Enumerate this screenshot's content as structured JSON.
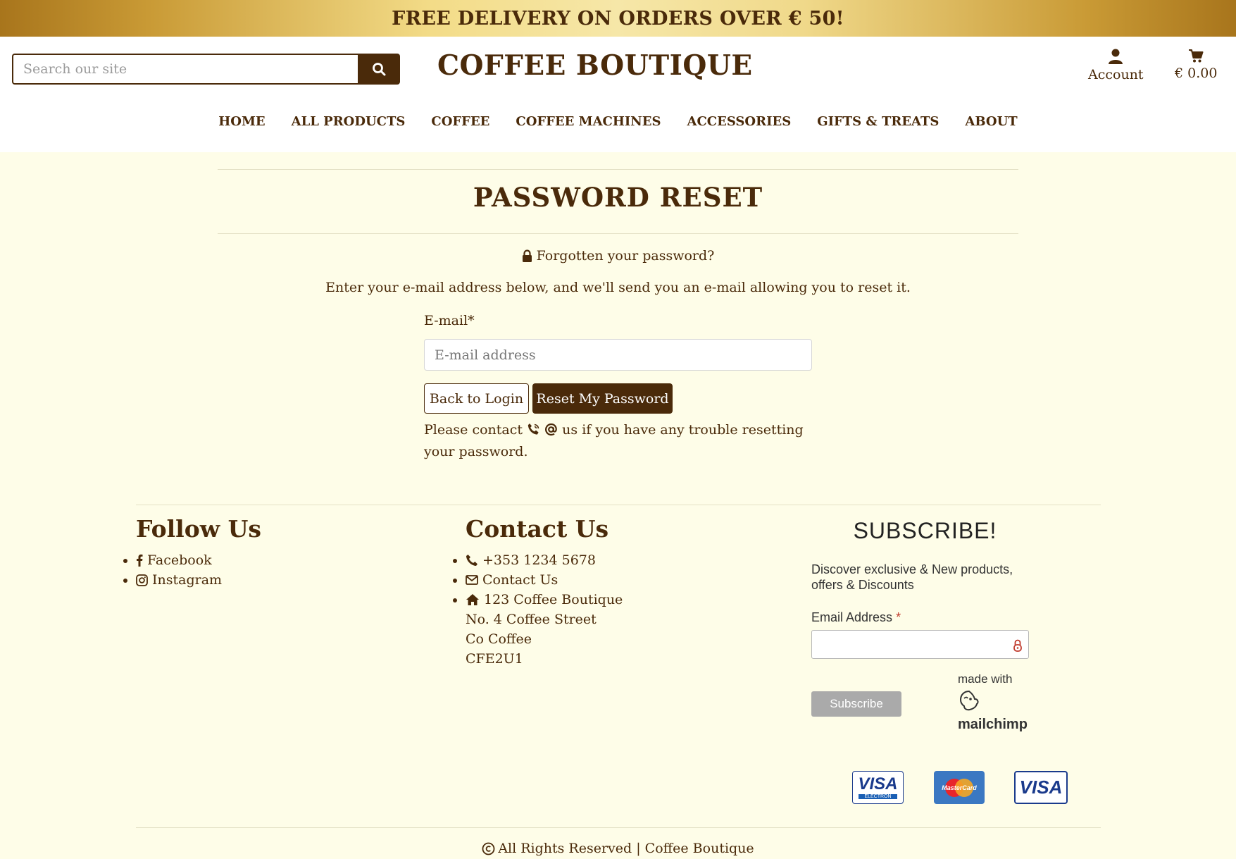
{
  "promo": {
    "text": "FREE DELIVERY ON ORDERS OVER € 50!"
  },
  "header": {
    "search_placeholder": "Search our site",
    "brand": "COFFEE BOUTIQUE",
    "account_label": "Account",
    "cart_total": "€ 0.00"
  },
  "nav": {
    "items": [
      "HOME",
      "ALL PRODUCTS",
      "COFFEE",
      "COFFEE MACHINES",
      "ACCESSORIES",
      "GIFTS & TREATS",
      "ABOUT"
    ]
  },
  "main": {
    "title": "PASSWORD RESET",
    "forgot": "Forgotten your password?",
    "instructions": "Enter your e-mail address below, and we'll send you an e-mail allowing you to reset it.",
    "email_label": "E-mail*",
    "email_placeholder": "E-mail address",
    "back_button": "Back to Login",
    "reset_button": "Reset My Password",
    "contact_pre": "Please contact",
    "contact_post": "us if you have any trouble resetting your password."
  },
  "footer": {
    "follow_title": "Follow Us",
    "follow_links": [
      "Facebook",
      "Instagram"
    ],
    "contact_title": "Contact Us",
    "phone": "+353 1234 5678",
    "contact_link": "Contact Us",
    "address": [
      "123 Coffee Boutique",
      "No. 4 Coffee Street",
      "Co Coffee",
      "CFE2U1"
    ],
    "subscribe_title": "SUBSCRIBE!",
    "subscribe_desc": "Discover exclusive & New products, offers & Discounts",
    "subscribe_label": "Email Address",
    "subscribe_required": "*",
    "subscribe_button": "Subscribe",
    "mailchimp_made": "made with",
    "mailchimp_brand": "mailchimp",
    "cards": [
      "VISA",
      "MasterCard",
      "VISA"
    ],
    "card_sub": "ELECTRON",
    "copyright": "All Rights Reserved | Coffee Boutique"
  },
  "colors": {
    "brand": "#4a2a0a",
    "page_bg": "#fefde8",
    "gold": "#d4ab4a"
  },
  "icons": [
    "search-icon",
    "user-icon",
    "cart-icon",
    "lock-icon",
    "phone-icon",
    "at-icon",
    "facebook-icon",
    "instagram-icon",
    "envelope-icon",
    "home-icon",
    "copyright-icon"
  ]
}
